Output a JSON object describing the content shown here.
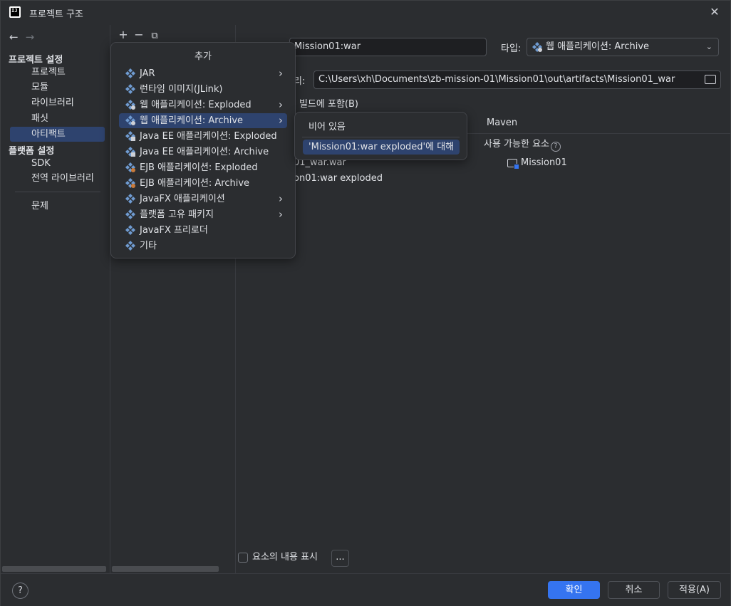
{
  "window": {
    "title": "프로젝트 구조"
  },
  "nav": {
    "section_project": "프로젝트 설정",
    "items_project": [
      "프로젝트",
      "모듈",
      "라이브러리",
      "패싯",
      "아티팩트"
    ],
    "section_platform": "플랫폼 설정",
    "items_platform": [
      "SDK",
      "전역 라이브러리"
    ],
    "problems": "문제",
    "selected": "아티팩트"
  },
  "toolbar": {
    "add": "+",
    "remove": "−",
    "copy": "⧉"
  },
  "artifact": {
    "name_value": "Mission01:war",
    "type_label": "타입:",
    "type_value": "웹 애플리케이션: Archive",
    "dir_label_suffix": "리:",
    "dir_value": "C:\\Users\\xh\\Documents\\zb-mission-01\\Mission01\\out\\artifacts\\Mission01_war",
    "include_label": "빌드에 포함(B)",
    "tab_maven": "Maven",
    "available_label": "사용 가능한 요소",
    "tree_war": "01_war.war",
    "tree_exploded": "on01:war exploded",
    "module_name": "Mission01",
    "show_contents": "요소의 내용 표시",
    "more": "..."
  },
  "popup": {
    "title": "추가",
    "items": [
      {
        "label": "JAR",
        "submenu": true
      },
      {
        "label": "런타임 이미지(JLink)",
        "submenu": false
      },
      {
        "label": "웹 애플리케이션: Exploded",
        "submenu": true
      },
      {
        "label": "웹 애플리케이션: Archive",
        "submenu": true
      },
      {
        "label": "Java EE 애플리케이션: Exploded",
        "submenu": false
      },
      {
        "label": "Java EE 애플리케이션: Archive",
        "submenu": false
      },
      {
        "label": "EJB 애플리케이션: Exploded",
        "submenu": false
      },
      {
        "label": "EJB 애플리케이션: Archive",
        "submenu": false
      },
      {
        "label": "JavaFX 애플리케이션",
        "submenu": true
      },
      {
        "label": "플랫폼 고유 패키지",
        "submenu": true
      },
      {
        "label": "JavaFX 프리로더",
        "submenu": false
      },
      {
        "label": "기타",
        "submenu": false
      }
    ],
    "hover_index": 3
  },
  "subpopup": {
    "empty": "비어 있음",
    "item": "'Mission01:war exploded'에 대해"
  },
  "buttons": {
    "help": "?",
    "ok": "확인",
    "cancel": "취소",
    "apply": "적용(A)"
  },
  "colors": {
    "accent": "#3574f0",
    "selection": "#2e436e",
    "background": "#2b2d30",
    "icon": "#6f9bd1"
  }
}
